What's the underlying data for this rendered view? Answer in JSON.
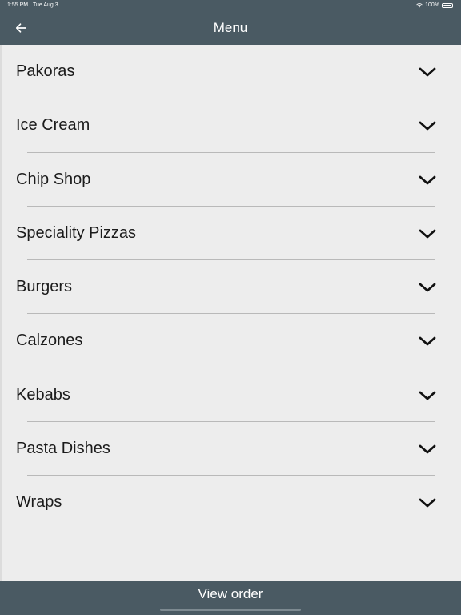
{
  "status_bar": {
    "time": "1:55 PM",
    "date": "Tue Aug 3",
    "battery": "100%"
  },
  "nav": {
    "back_icon": "arrow-left-icon",
    "title": "Menu"
  },
  "menu": {
    "items": [
      {
        "label": "Pakoras"
      },
      {
        "label": "Ice Cream"
      },
      {
        "label": "Chip Shop"
      },
      {
        "label": "Speciality Pizzas"
      },
      {
        "label": "Burgers"
      },
      {
        "label": "Calzones"
      },
      {
        "label": "Kebabs"
      },
      {
        "label": "Pasta Dishes"
      },
      {
        "label": "Wraps"
      }
    ],
    "expand_icon": "chevron-down-icon"
  },
  "footer": {
    "view_order_label": "View order"
  },
  "colors": {
    "bar": "#4a5a63",
    "background": "#ededed",
    "divider": "#b9b9b9",
    "text": "#1b1b1b"
  }
}
